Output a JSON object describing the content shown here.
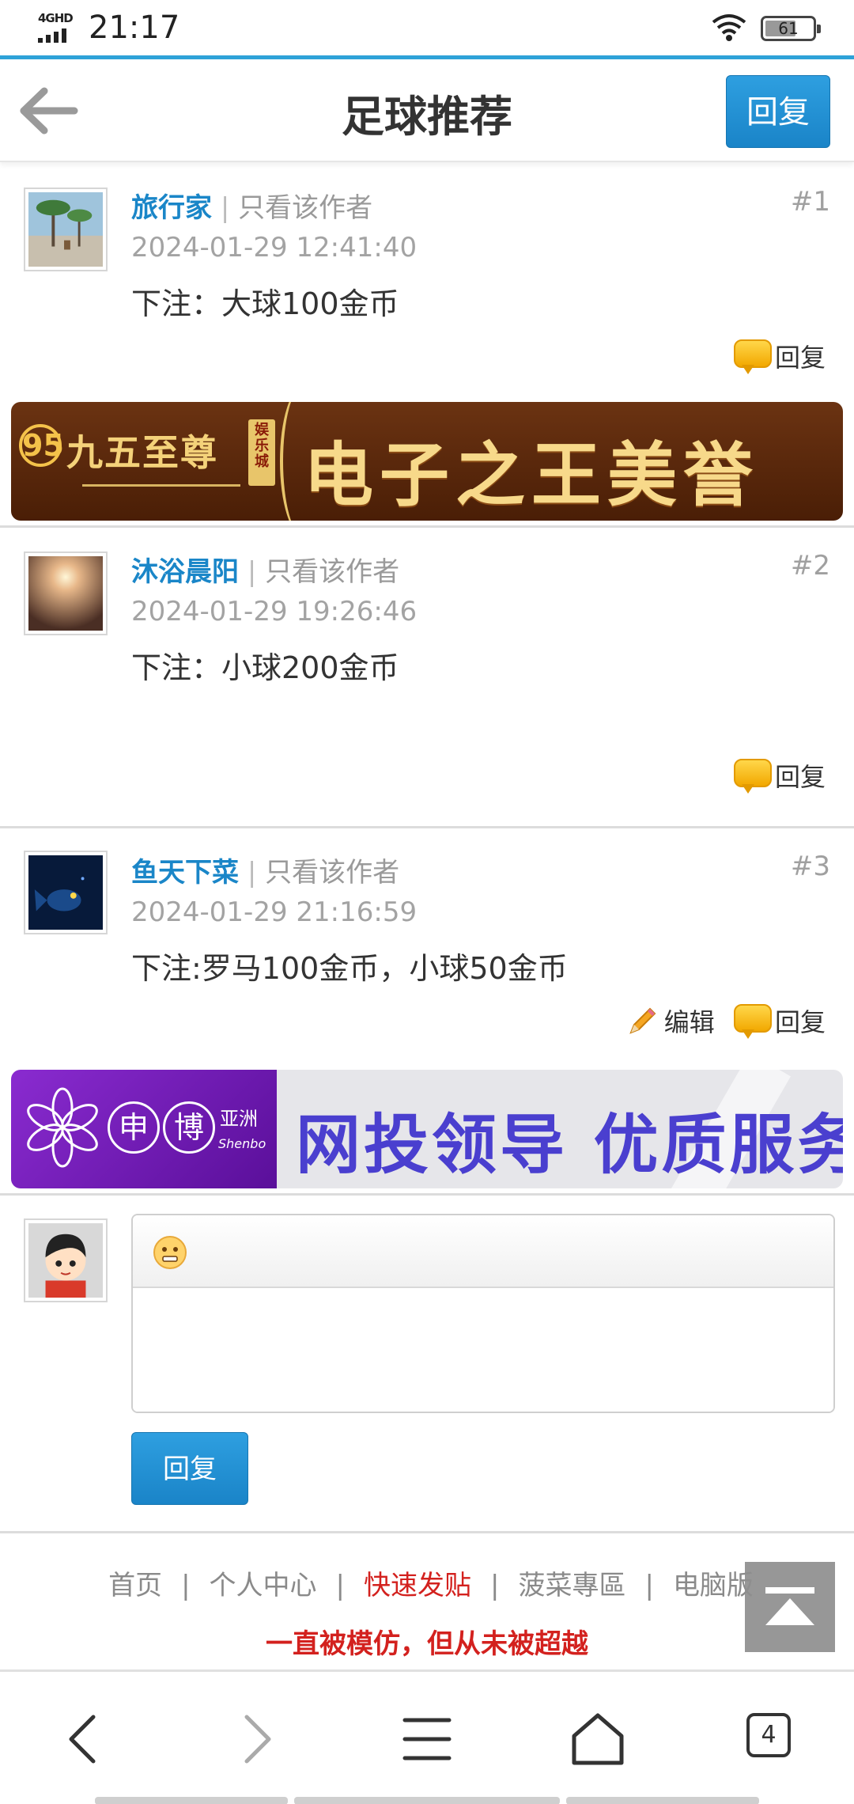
{
  "status_bar": {
    "network": "4GHD",
    "time": "21:17",
    "battery": "61"
  },
  "header": {
    "title": "足球推荐",
    "reply_label": "回复",
    "back_icon": "arrow-left-icon"
  },
  "posts": [
    {
      "author": "旅行家",
      "only_author": "只看该作者",
      "separator": "|",
      "floor": "#1",
      "time": "2024-01-29 12:41:40",
      "content": "下注：大球100金币",
      "reply_label": "回复"
    },
    {
      "author": "沐浴晨阳",
      "only_author": "只看该作者",
      "separator": "|",
      "floor": "#2",
      "time": "2024-01-29 19:26:46",
      "content": "下注：小球200金币",
      "reply_label": "回复"
    },
    {
      "author": "鱼天下菜",
      "only_author": "只看该作者",
      "separator": "|",
      "floor": "#3",
      "time": "2024-01-29 21:16:59",
      "content": "下注:罗马100金币，小球50金币",
      "edit_label": "编辑",
      "reply_label": "回复"
    }
  ],
  "banners": [
    {
      "brand": "九五至尊",
      "circle": "95",
      "tag": "娱乐城",
      "slogan": "电子之王美誉"
    },
    {
      "char1": "申",
      "char2": "博",
      "asia": "亚洲",
      "shenbo": "Shenbo",
      "slogan": "网投领导  优质服务"
    }
  ],
  "reply_form": {
    "submit_label": "回复"
  },
  "footer": {
    "links": [
      "首页",
      "个人中心",
      "快速发贴",
      "菠菜專區",
      "电脑版"
    ],
    "separator": "|",
    "slogan": "一直被模仿，但从未被超越"
  },
  "browser": {
    "tabs_count": "4"
  },
  "colors": {
    "accent": "#1a86c8",
    "button": "#2e9fe0",
    "hot": "#d3211e"
  }
}
